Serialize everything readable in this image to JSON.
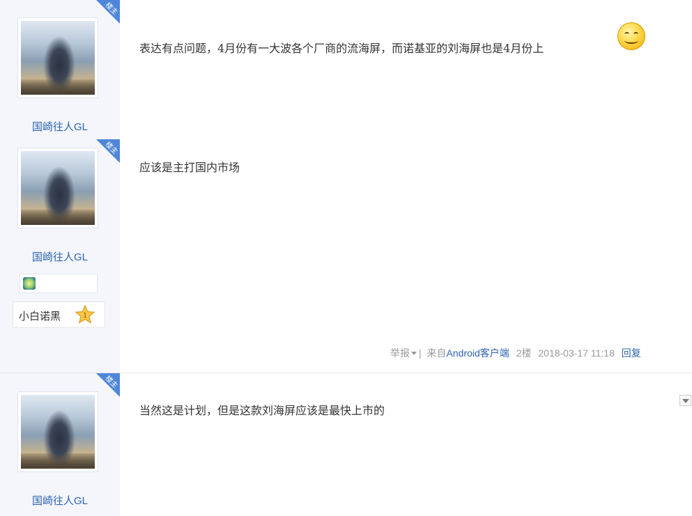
{
  "posts": [
    {
      "username": "国崎往人GL",
      "badge": "楼主",
      "avatar": "optimus-prime-avatar",
      "text": "表达有点问题，4月份有一大波各个厂商的流海屏，而诺基亚的刘海屏也是4月份上",
      "emoji": "smile-emoji"
    },
    {
      "username": "国崎往人GL",
      "badge": "楼主",
      "avatar": "optimus-prime-avatar",
      "text": "应该是主打国内市场",
      "honor_icon": "honor-badge-icon",
      "level_name": "小白诺黑",
      "level_number": "1",
      "meta": {
        "report": "举报",
        "separator": "|",
        "from_prefix": "来自",
        "client": "Android客户端",
        "floor": "2楼",
        "datetime": "2018-03-17 11:18",
        "reply": "回复"
      }
    },
    {
      "username": "国崎往人GL",
      "badge": "楼主",
      "avatar": "optimus-prime-avatar",
      "text": "当然这是计划，但是这款刘海屏应该是最快上市的",
      "dropdown_icon": "chevron-down-icon"
    }
  ],
  "colors": {
    "sidebar_bg": "#f4f6fb",
    "badge_blue": "#4f86d9",
    "link_blue": "#2d64b3",
    "meta_gray": "#999999"
  }
}
